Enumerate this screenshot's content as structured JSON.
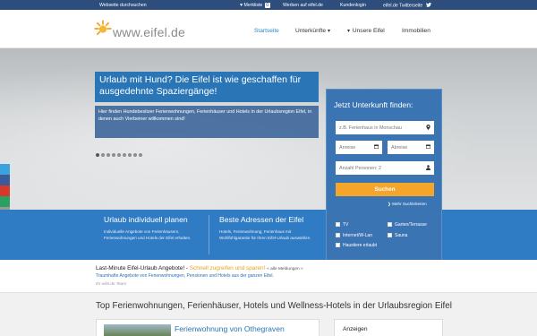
{
  "topbar": {
    "search": "Webseite durchsuchen",
    "wishlist": "♥ Merkliste",
    "wishlist_count": "0",
    "advertise": "Werben auf eifel.de",
    "customer_login": "Kundenlogin",
    "twitter": "eifel.de Twitterseite"
  },
  "header": {
    "logo": "www.eifel.de",
    "nav": [
      {
        "label": "Startseite"
      },
      {
        "label": "Unterkünfte"
      },
      {
        "label": "Unsere Eifel"
      },
      {
        "label": "Immobilien"
      }
    ]
  },
  "hero": {
    "headline": "Urlaub mit Hund? Die Eifel ist wie geschaffen für ausgedehnte Spaziergänge!",
    "subtext": "Hier finden Hundebesitzer Ferienwohnungen, Ferienhäuser und Hotels in der Urlaubsregion Eifel, in denen auch Vierbeiner willkommen sind!",
    "slide_count": 9,
    "active_slide": 1
  },
  "search": {
    "title": "Jetzt Unterkunft finden:",
    "location_placeholder": "z.B. Ferienhaus in Monschau",
    "arrival_placeholder": "Anreise",
    "departure_placeholder": "Abreise",
    "persons": "Anzahl Personen: 2",
    "button": "Suchen",
    "more_criteria": "Mehr Suchkriterien",
    "options": [
      "TV",
      "Garten/Terrasse",
      "Internet/W-Lan",
      "Sauna",
      "Haustiere erlaubt"
    ]
  },
  "band": {
    "col1_title": "Urlaub individuell planen",
    "col1_text": "Individuelle Angebote von Ferienhäusern, Ferienwohnungen und Hotels der Eifel erhalten.",
    "col2_title": "Beste Adressen der Eifel",
    "col2_text": "Hotels, Ferienwohnung, Ferienhaus mit Wohlfühlgarantie für Ihren Eifel-Urlaub auswählen."
  },
  "lastminute": {
    "label": "Last-Minute Eifel-Urlaub Angebote! -",
    "highlight": "Schnell zugreifen und sparen!",
    "all_link": "« alle Meldungen »",
    "line2": "Traumhafte Angebote von Ferienwohnungen, Pensionen und Hotels aus der ganzen Eifel.",
    "line3": "Ihr eifel.de Team"
  },
  "bottom": {
    "title": "Top Ferienwohnungen, Ferienhäuser, Hotels und Wellness-Hotels in der Urlaubsregion Eifel",
    "card_title": "Ferienwohnung von Othegraven",
    "ads_title": "Anzeigen"
  },
  "colors": {
    "topbar": "#2d4e7c",
    "accent_blue": "#2a75b6",
    "band_blue": "#2f7cc4",
    "search_orange": "#f4a52a",
    "logo_orange": "#f2a21b"
  },
  "icons": [
    "sun-logo-icon",
    "heart-icon",
    "twitter-icon",
    "map-pin-icon",
    "calendar-icon",
    "person-icon",
    "chevron-down-icon",
    "arrow-right-icon",
    "checkbox-icon"
  ]
}
